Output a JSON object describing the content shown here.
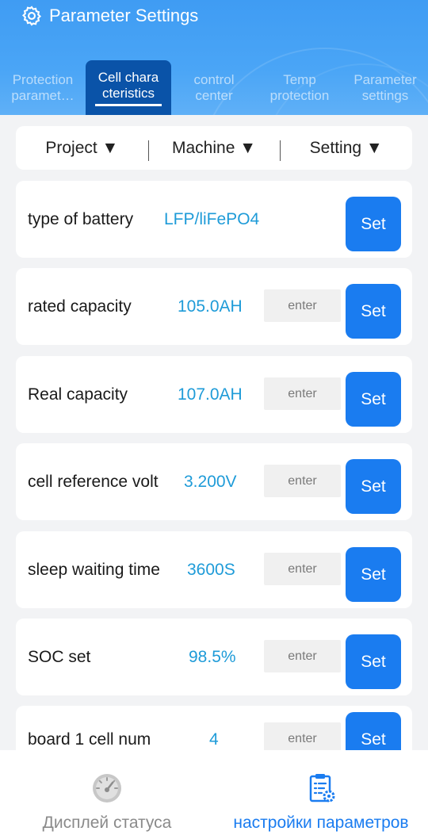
{
  "header": {
    "title": "Parameter Settings",
    "icon": "gear-icon"
  },
  "tabs": [
    {
      "line1": "Protection",
      "line2": "paramet…",
      "active": false
    },
    {
      "line1": "Cell chara",
      "line2": "cteristics",
      "active": true
    },
    {
      "line1": "control",
      "line2": "center",
      "active": false
    },
    {
      "line1": "Temp",
      "line2": "protection",
      "active": false
    },
    {
      "line1": "Parameter",
      "line2": "settings",
      "active": false
    }
  ],
  "filters": [
    {
      "label": "Project ▼"
    },
    {
      "label": "Machine ▼"
    },
    {
      "label": "Setting ▼"
    }
  ],
  "settings": [
    {
      "label": "type of battery",
      "value": "LFP/liFePO4",
      "placeholder": "",
      "button": "Set"
    },
    {
      "label": "rated capacity",
      "value": "105.0AH",
      "placeholder": "enter",
      "button": "Set"
    },
    {
      "label": "Real capacity",
      "value": "107.0AH",
      "placeholder": "enter",
      "button": "Set"
    },
    {
      "label": "cell reference volt",
      "value": "3.200V",
      "placeholder": "enter",
      "button": "Set"
    },
    {
      "label": "sleep waiting time",
      "value": "3600S",
      "placeholder": "enter",
      "button": "Set"
    },
    {
      "label": "SOC set",
      "value": "98.5%",
      "placeholder": "enter",
      "button": "Set"
    },
    {
      "label": "board 1 cell num",
      "value": "4",
      "placeholder": "enter",
      "button": "Set"
    }
  ],
  "bottom_nav": [
    {
      "label": "Дисплей статуса",
      "icon": "speedometer-icon",
      "active": false
    },
    {
      "label": "настройки параметров",
      "icon": "clipboard-settings-icon",
      "active": true
    }
  ],
  "colors": {
    "header_blue": "#4aa5f6",
    "active_tab": "#0a53a8",
    "accent_blue": "#1a7cf0",
    "value_cyan": "#1e9bd8"
  }
}
